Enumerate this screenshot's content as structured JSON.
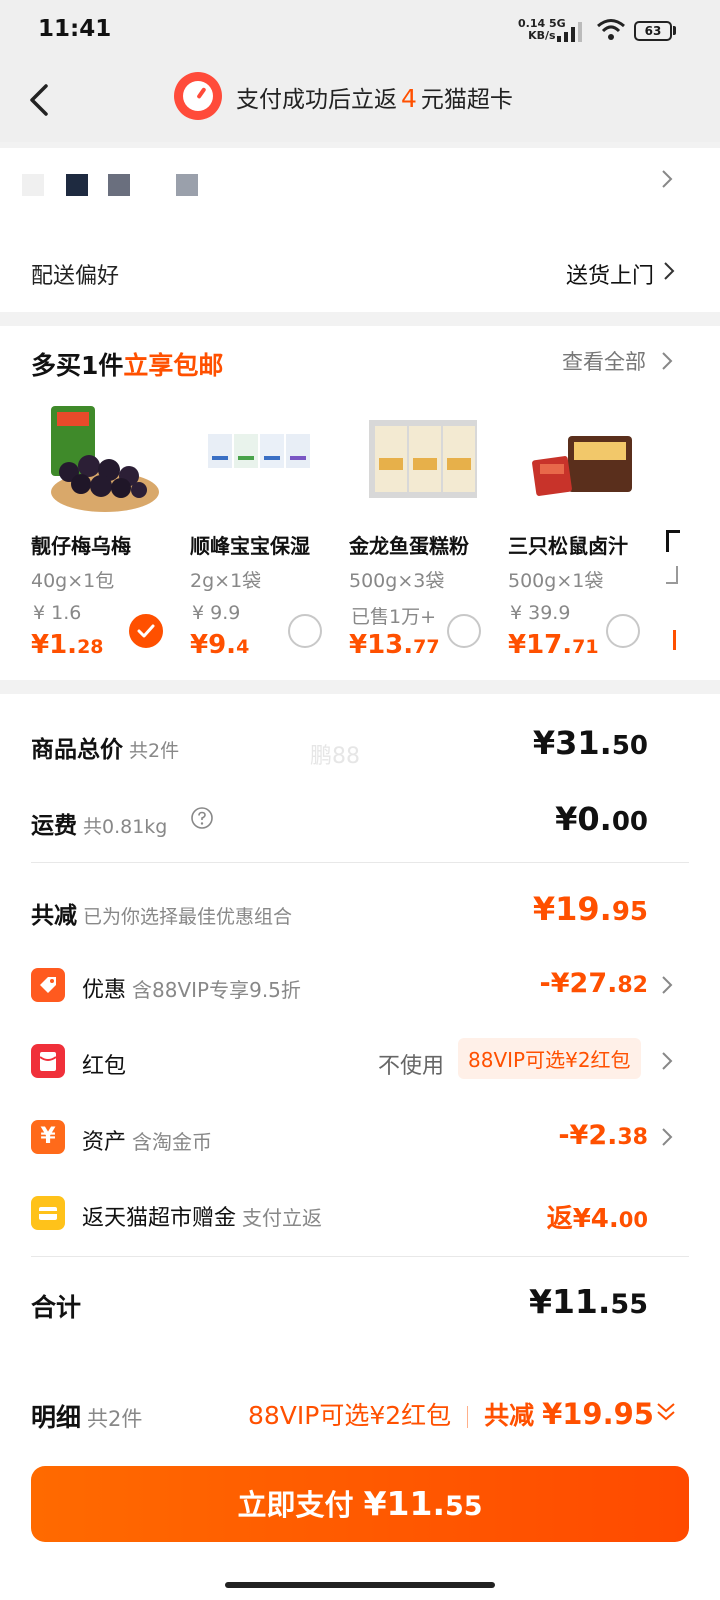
{
  "status_bar": {
    "time": "11:41",
    "net_speed": "0.14",
    "net_unit": "KB/s",
    "network_type": "5G",
    "battery": "63"
  },
  "header": {
    "title_prefix": "支付成功后立返",
    "title_amount": "4",
    "title_suffix": "元猫超卡",
    "back_icon": "chevron-left-icon",
    "badge_icon": "alarm-clock-icon"
  },
  "address": {
    "delivery_pref_label": "配送偏好",
    "delivery_pref_value": "送货上门"
  },
  "promo": {
    "title_prefix": "多买1件",
    "title_highlight": "立享包邮",
    "view_all": "查看全部",
    "products": [
      {
        "name": "靓仔梅乌梅",
        "spec": "40g×1包",
        "orig": "¥ 1.6",
        "price_big": "¥1.",
        "price_small": "28",
        "selected": true
      },
      {
        "name": "顺峰宝宝保湿",
        "spec": "2g×1袋",
        "orig": "¥ 9.9",
        "price_big": "¥9.",
        "price_small": "4",
        "selected": false
      },
      {
        "name": "金龙鱼蛋糕粉",
        "spec": "500g×3袋",
        "orig": "已售1万+",
        "price_big": "¥13.",
        "price_small": "77",
        "selected": false
      },
      {
        "name": "三只松鼠卤汁",
        "spec": "500g×1袋",
        "orig": "¥ 39.9",
        "price_big": "¥17.",
        "price_small": "71",
        "selected": false
      }
    ]
  },
  "summary": {
    "goods_total_label": "商品总价",
    "goods_total_count": "共2件",
    "goods_total_big": "¥31.",
    "goods_total_small": "50",
    "shipping_label": "运费",
    "shipping_weight": "共0.81kg",
    "shipping_big": "¥0.",
    "shipping_small": "00",
    "discount_total_label": "共减",
    "discount_total_note": "已为你选择最佳优惠组合",
    "discount_total_big": "¥19.",
    "discount_total_small": "95",
    "coupon_label": "优惠",
    "coupon_note": "含88VIP专享9.5折",
    "coupon_big": "-¥27.",
    "coupon_small": "82",
    "redpacket_label": "红包",
    "redpacket_value": "不使用",
    "redpacket_tag": "88VIP可选¥2红包",
    "assets_label": "资产",
    "assets_note": "含淘金币",
    "assets_big": "-¥2.",
    "assets_small": "38",
    "cashback_label": "返天猫超市赠金",
    "cashback_note": "支付立返",
    "cashback_prefix": "返¥4.",
    "cashback_small": "00",
    "total_label": "合计",
    "total_big": "¥11.",
    "total_small": "55",
    "watermark": "鹏88"
  },
  "bottom": {
    "detail_label": "明细",
    "detail_count": "共2件",
    "detail_vip": "88VIP可选¥2红包",
    "detail_reduce_label": "共减",
    "detail_reduce_amount": "¥19.95",
    "pay_label": "立即支付",
    "pay_big": "¥11.",
    "pay_small": "55"
  },
  "colors": {
    "accent": "#ff5000",
    "page_bg": "#f2f2f2"
  }
}
